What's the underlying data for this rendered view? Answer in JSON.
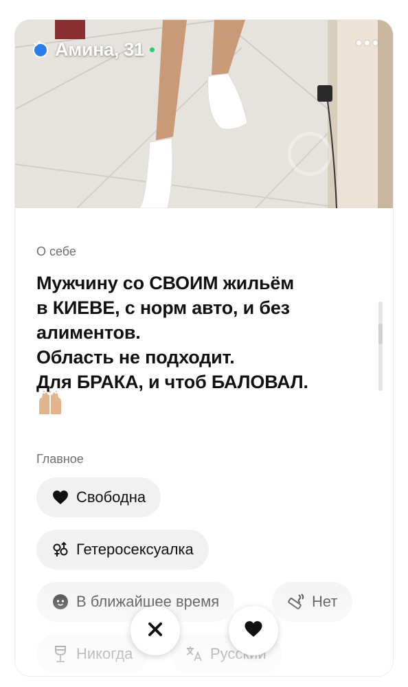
{
  "profile": {
    "name_age": "Амина, 31"
  },
  "about": {
    "label": "О себе",
    "lines": [
      "Мужчину со СВОИМ жильём",
      "в КИЕВЕ, с норм авто, и без",
      "алиментов.",
      "Область не подходит.",
      "Для БРАКА, и чтоб БАЛОВАЛ."
    ],
    "emoji": "raising-hands"
  },
  "main": {
    "label": "Главное",
    "chips": [
      {
        "icon": "heart-icon",
        "label": "Свободна"
      },
      {
        "icon": "gender-icon",
        "label": "Гетеросексуалка"
      },
      {
        "icon": "baby-icon",
        "label": "В ближайшее время"
      },
      {
        "icon": "cigarette-icon",
        "label": "Нет"
      },
      {
        "icon": "wine-glass-icon",
        "label": "Никогда"
      },
      {
        "icon": "translate-icon",
        "label": "Русский"
      }
    ]
  },
  "colors": {
    "verified": "#2b7de9",
    "online": "#2ecc71",
    "chip_bg": "#f1f1f1"
  }
}
